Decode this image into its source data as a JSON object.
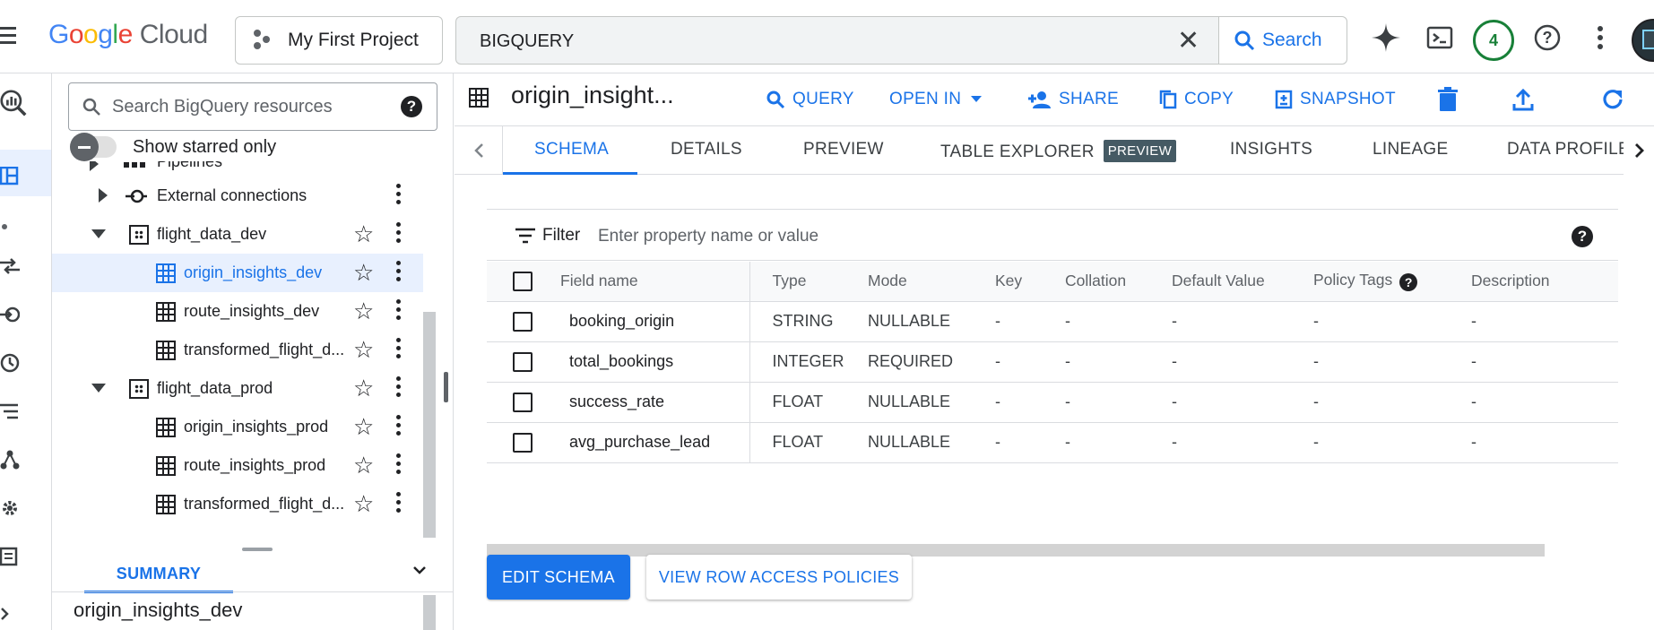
{
  "topbar": {
    "logo": {
      "letters": [
        "G",
        "o",
        "o",
        "g",
        "l",
        "e"
      ],
      "product": "Cloud"
    },
    "project": {
      "label": "My First Project",
      "icon": "project-dots-icon"
    },
    "search": {
      "value": "BIGQUERY",
      "button_label": "Search"
    },
    "notifications_count": "4",
    "icons": [
      "menu-icon",
      "gemini-spark-icon",
      "cloud-shell-icon",
      "help-icon",
      "more-vert-icon",
      "avatar"
    ]
  },
  "explorer": {
    "search_placeholder": "Search BigQuery resources",
    "starred_toggle_label": "Show starred only",
    "tree": [
      {
        "label": "Pipelines",
        "type": "group",
        "partial": true
      },
      {
        "label": "External connections",
        "type": "group"
      },
      {
        "label": "flight_data_dev",
        "type": "dataset",
        "expanded": true
      },
      {
        "label": "origin_insights_dev",
        "type": "table",
        "selected": true
      },
      {
        "label": "route_insights_dev",
        "type": "table"
      },
      {
        "label": "transformed_flight_d...",
        "type": "table"
      },
      {
        "label": "flight_data_prod",
        "type": "dataset",
        "expanded": true
      },
      {
        "label": "origin_insights_prod",
        "type": "table"
      },
      {
        "label": "route_insights_prod",
        "type": "table"
      },
      {
        "label": "transformed_flight_d...",
        "type": "table"
      }
    ],
    "summary_tab": "SUMMARY",
    "summary_title": "origin_insights_dev"
  },
  "main": {
    "title": "origin_insight...",
    "actions": [
      "QUERY",
      "OPEN IN",
      "SHARE",
      "COPY",
      "SNAPSHOT"
    ],
    "tabs": [
      "SCHEMA",
      "DETAILS",
      "PREVIEW",
      "TABLE EXPLORER",
      "INSIGHTS",
      "LINEAGE",
      "DATA PROFILE"
    ],
    "preview_badge": "PREVIEW",
    "active_tab": "SCHEMA",
    "filter": {
      "label": "Filter",
      "placeholder": "Enter property name or value"
    },
    "columns": [
      "Field name",
      "Type",
      "Mode",
      "Key",
      "Collation",
      "Default Value",
      "Policy Tags",
      "Description"
    ],
    "rows": [
      {
        "name": "booking_origin",
        "type": "STRING",
        "mode": "NULLABLE",
        "key": "-",
        "collation": "-",
        "default": "-",
        "policy": "-",
        "desc": "-"
      },
      {
        "name": "total_bookings",
        "type": "INTEGER",
        "mode": "REQUIRED",
        "key": "-",
        "collation": "-",
        "default": "-",
        "policy": "-",
        "desc": "-"
      },
      {
        "name": "success_rate",
        "type": "FLOAT",
        "mode": "NULLABLE",
        "key": "-",
        "collation": "-",
        "default": "-",
        "policy": "-",
        "desc": "-"
      },
      {
        "name": "avg_purchase_lead",
        "type": "FLOAT",
        "mode": "NULLABLE",
        "key": "-",
        "collation": "-",
        "default": "-",
        "policy": "-",
        "desc": "-"
      }
    ],
    "buttons": {
      "edit_schema": "EDIT SCHEMA",
      "row_access": "VIEW ROW ACCESS POLICIES"
    }
  },
  "colors": {
    "accent": "#1a73e8",
    "badge_green": "#188038",
    "selected_bg": "#e8f0fe",
    "preview_badge_bg": "#455a64"
  }
}
